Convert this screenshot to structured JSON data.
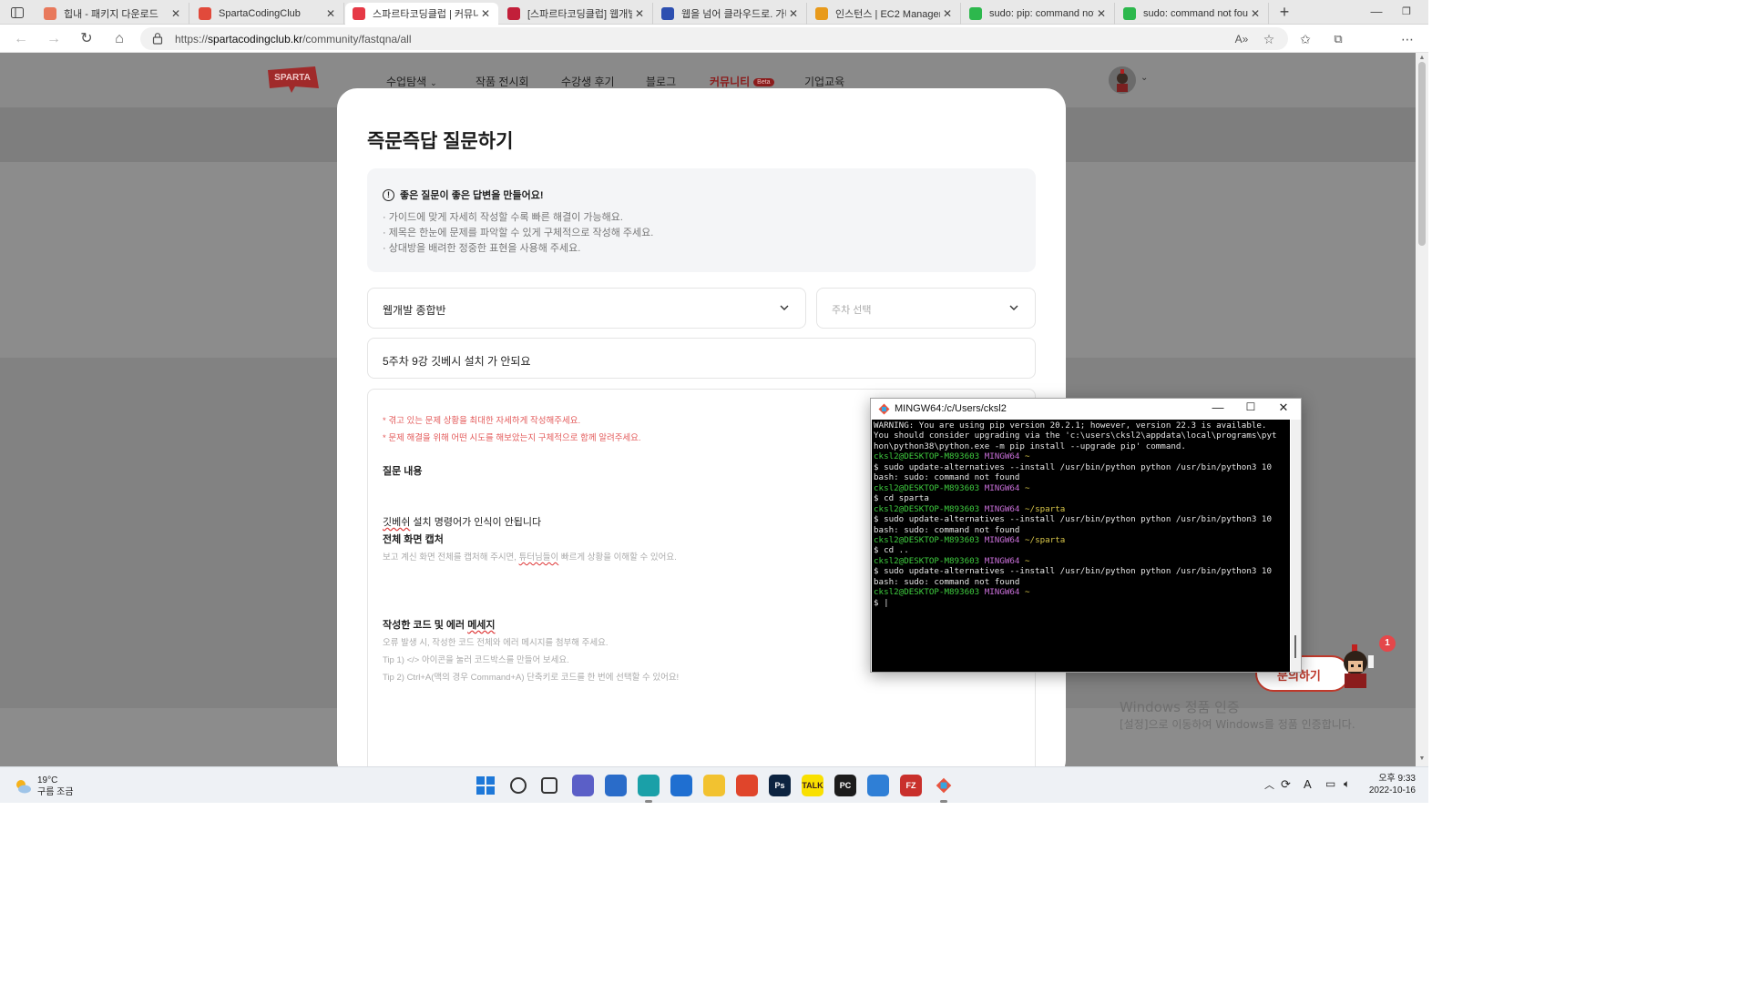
{
  "browser": {
    "tabs": [
      {
        "title": "힙내 - 패키지 다운로드",
        "favicon_color": "#e8795c",
        "favicon": "diamond-icon"
      },
      {
        "title": "SpartaCodingClub",
        "favicon_color": "#e14a3b",
        "favicon": "sparta-icon"
      },
      {
        "title": "스파르타코딩클럽 | 커뮤니",
        "favicon_color": "#e63946",
        "favicon": "heart-icon"
      },
      {
        "title": "[스파르타코딩클럽] 웹개발",
        "favicon_color": "#c21f3a",
        "favicon": "book-icon"
      },
      {
        "title": "웹을 넘어 클라우드로. 가비",
        "favicon_color": "#2d4fb0",
        "favicon": "g-icon"
      },
      {
        "title": "인스턴스 | EC2 Manageme",
        "favicon_color": "#e89a1b",
        "favicon": "box-icon"
      },
      {
        "title": "sudo: pip: command not fo",
        "favicon_color": "#2db84d",
        "favicon": "chat-icon"
      },
      {
        "title": "sudo: command not found",
        "favicon_color": "#2db84d",
        "favicon": "chat-icon"
      }
    ],
    "active_tab": 2,
    "url_prefix": "https://",
    "url_host": "spartacodingclub.kr",
    "url_path": "/community/fastqna/all"
  },
  "site": {
    "logo_text": "SPARTA",
    "nav": [
      {
        "label": "수업탐색",
        "dropdown": true
      },
      {
        "label": "작품 전시회"
      },
      {
        "label": "수강생 후기"
      },
      {
        "label": "블로그"
      },
      {
        "label": "커뮤니티",
        "badge": "Beta",
        "active": true
      },
      {
        "label": "기업교육"
      }
    ]
  },
  "modal": {
    "title": "즉문즉답 질문하기",
    "guide": {
      "title": "좋은 질문이 좋은 답변을 만들어요!",
      "lines": [
        "· 가이드에 맞게 자세히 작성할 수록 빠른 해결이 가능해요.",
        "· 제목은 한눈에 문제를 파악할 수 있게 구체적으로 작성해 주세요.",
        "· 상대방을 배려한 정중한 표현을 사용해 주세요."
      ]
    },
    "course_select": "웹개발 종합반",
    "week_select_placeholder": "주차 선택",
    "question_title": "5주차 9강 깃베시 설치 가 안되요",
    "editor": {
      "warn1": "* 겪고 있는 문제 상황을 최대한 자세하게 작성해주세요.",
      "warn2": "* 문제 해결을 위해 어떤 시도를 해보았는지 구체적으로 함께 알려주세요.",
      "h1": "질문 내용",
      "body_misspelled": "깃베쉬",
      "body_rest": " 설치 명령어가 인식이 안됩니다",
      "h2": "전체 화면 캡처",
      "p2_before": "보고 계신 화면 전체를 캡처해 주시면, ",
      "p2_misspelled": "튜터님들이",
      "p2_after": " 빠르게 상황을 이해할 수 있어요.",
      "h3_before": "작성한 코드 및 에러 ",
      "h3_misspelled": "메세지",
      "p3": "오류 발생 시, 작성한 코드 전체와 에러 메시지를 첨부해 주세요.",
      "p4": "Tip 1) </> 아이콘을 눌러 코드박스를 만들어 보세요.",
      "p5": "Tip 2) Ctrl+A(맥의 경우 Command+A) 단축키로 코드를 한 번에 선택할 수 있어요!"
    }
  },
  "floating": {
    "button_label": "문의하기",
    "badge_count": "1"
  },
  "watermark": {
    "title": "Windows 정품 인증",
    "subtitle": "[설정]으로 이동하여 Windows를 정품 인증합니다."
  },
  "terminal": {
    "title": "MINGW64:/c/Users/cksl2",
    "lines": [
      {
        "t": "WARNING: You are using pip version 20.2.1; however, version 22.3 is available."
      },
      {
        "t": "You should consider upgrading via the 'c:\\users\\cksl2\\appdata\\local\\programs\\pyt"
      },
      {
        "t": "hon\\python38\\python.exe -m pip install --upgrade pip' command."
      },
      {
        "t": ""
      },
      {
        "prompt": true,
        "user": "cksl2@DESKTOP-M893603",
        "sys": "MINGW64",
        "path": "~"
      },
      {
        "t": "$ sudo update-alternatives --install /usr/bin/python python /usr/bin/python3 10"
      },
      {
        "t": "bash: sudo: command not found"
      },
      {
        "t": ""
      },
      {
        "prompt": true,
        "user": "cksl2@DESKTOP-M893603",
        "sys": "MINGW64",
        "path": "~"
      },
      {
        "t": "$ cd sparta"
      },
      {
        "t": ""
      },
      {
        "prompt": true,
        "user": "cksl2@DESKTOP-M893603",
        "sys": "MINGW64",
        "path": "~/sparta"
      },
      {
        "t": "$ sudo update-alternatives --install /usr/bin/python python /usr/bin/python3 10"
      },
      {
        "t": "bash: sudo: command not found"
      },
      {
        "t": ""
      },
      {
        "prompt": true,
        "user": "cksl2@DESKTOP-M893603",
        "sys": "MINGW64",
        "path": "~/sparta"
      },
      {
        "t": "$ cd .."
      },
      {
        "t": ""
      },
      {
        "prompt": true,
        "user": "cksl2@DESKTOP-M893603",
        "sys": "MINGW64",
        "path": "~"
      },
      {
        "t": "$ sudo update-alternatives --install /usr/bin/python python /usr/bin/python3 10"
      },
      {
        "t": "bash: sudo: command not found"
      },
      {
        "t": ""
      },
      {
        "prompt": true,
        "user": "cksl2@DESKTOP-M893603",
        "sys": "MINGW64",
        "path": "~"
      },
      {
        "t": "$ |"
      }
    ]
  },
  "taskbar": {
    "weather_temp": "19°C",
    "weather_desc": "구름 조금",
    "time": "오후 9:33",
    "date": "2022-10-16",
    "apps": [
      {
        "name": "start-icon",
        "color": "#1e78d8",
        "label": ""
      },
      {
        "name": "search-icon",
        "color": "#333333",
        "label": ""
      },
      {
        "name": "task-view-icon",
        "color": "#333333",
        "label": ""
      },
      {
        "name": "teams-chat-icon",
        "color": "#5b5fc7",
        "label": ""
      },
      {
        "name": "store-icon",
        "color": "#2a6cc9",
        "label": ""
      },
      {
        "name": "edge-icon",
        "color": "#1aa0a8",
        "label": ""
      },
      {
        "name": "mail-icon",
        "color": "#1f6fd1",
        "label": ""
      },
      {
        "name": "file-explorer-icon",
        "color": "#f2c230",
        "label": ""
      },
      {
        "name": "office-icon",
        "color": "#e0452b",
        "label": ""
      },
      {
        "name": "photoshop-icon",
        "color": "#0c2340",
        "label": "Ps"
      },
      {
        "name": "kakaotalk-icon",
        "color": "#f9e000",
        "label": "TALK"
      },
      {
        "name": "pycharm-icon",
        "color": "#1c1c1c",
        "label": "PC"
      },
      {
        "name": "notepad-icon",
        "color": "#2f7fd6",
        "label": ""
      },
      {
        "name": "filezilla-icon",
        "color": "#c9302c",
        "label": "FZ"
      },
      {
        "name": "git-bash-icon",
        "color": "#e8e8e8",
        "label": ""
      }
    ],
    "tray_icons": [
      "chevron-up-icon",
      "sync-icon",
      "language-icon",
      "network-icon",
      "volume-icon"
    ],
    "tray_lang": "A"
  }
}
